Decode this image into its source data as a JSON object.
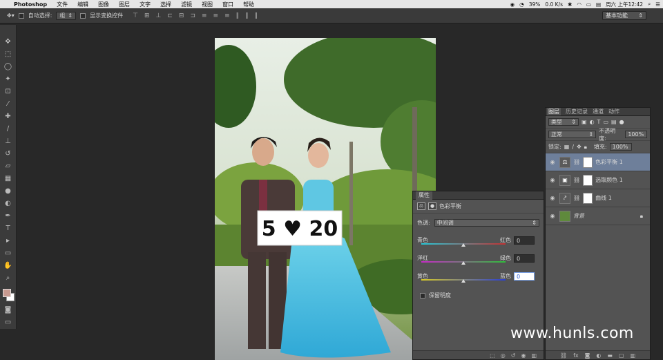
{
  "menubar": {
    "app": "Photoshop",
    "items": [
      "文件",
      "编辑",
      "图像",
      "图层",
      "文字",
      "选择",
      "滤镜",
      "视图",
      "窗口",
      "帮助"
    ],
    "battery": "39%",
    "network": "0.0 K/s",
    "clock": "周六 上午12:42"
  },
  "options": {
    "auto_select_label": "自动选择:",
    "auto_select_value": "组",
    "show_transform_label": "显示变换控件",
    "workspace": "基本功能"
  },
  "properties": {
    "tab": "属性",
    "title": "色彩平衡",
    "tone_label": "色调:",
    "tone_value": "中间调",
    "sliders": [
      {
        "left": "青色",
        "right": "红色",
        "value": "0",
        "position": 0.5
      },
      {
        "left": "洋红",
        "right": "绿色",
        "value": "0",
        "position": 0.5
      },
      {
        "left": "黄色",
        "right": "蓝色",
        "value": "0",
        "position": 0.5
      }
    ],
    "preserve_label": "保留明度"
  },
  "layers_panel": {
    "tabs": [
      "图层",
      "历史记录",
      "通道",
      "动作"
    ],
    "filter": "类型",
    "blend_mode": "正常",
    "opacity_label": "不透明度:",
    "opacity": "100%",
    "lock_label": "锁定:",
    "fill_label": "填充:",
    "fill": "100%",
    "layers": [
      {
        "name": "色彩平衡 1",
        "selected": true
      },
      {
        "name": "选取颜色 1",
        "selected": false
      },
      {
        "name": "曲线 1",
        "selected": false
      },
      {
        "name": "背景",
        "selected": false
      }
    ]
  },
  "photo": {
    "sign_text": "5 ♥ 20"
  },
  "watermark": "www.hunls.com"
}
